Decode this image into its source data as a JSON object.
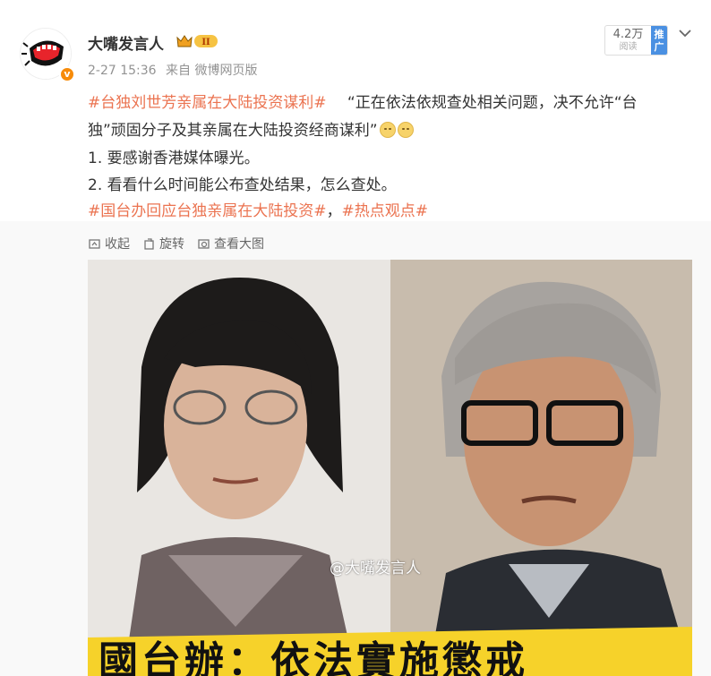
{
  "post": {
    "author": "大嘴发言人",
    "vip_level": "II",
    "time": "2-27 15:36",
    "source": "来自 微博网页版",
    "reads": "4.2万",
    "reads_label": "阅读",
    "promo_label": "推广",
    "icons": {
      "avatar": "avatar-mouth",
      "verify": "verified-badge",
      "vip": "crown-vip-badge",
      "menu": "chevron-down-icon",
      "emoji": "praying-emoji"
    },
    "line1": {
      "tag": "#台独刘世芳亲属在大陆投资谋利#",
      "text": "“正在依法依规查处相关问题，决不允许“台"
    },
    "line2": {
      "text": "独”顽固分子及其亲属在大陆投资经商谋利”"
    },
    "line3": "1.  要感谢香港媒体曝光。",
    "line4": "2.  看看什么时间能公布查处结果，怎么查处。",
    "line5": {
      "tag1": "#国台办回应台独亲属在大陆投资#",
      "sep": "，",
      "tag2": "#热点观点#"
    },
    "actions": {
      "collapse": "收起",
      "repost": "旋转",
      "view_large": "查看大图"
    },
    "image": {
      "watermark": "@大嘴发言人",
      "banner": "國台辦：依法實施懲戒"
    },
    "colors": {
      "tag": "#eb7350",
      "text": "#333333",
      "meta": "#939393",
      "promo": "#4a90e2",
      "verify": "#f78b09"
    }
  }
}
